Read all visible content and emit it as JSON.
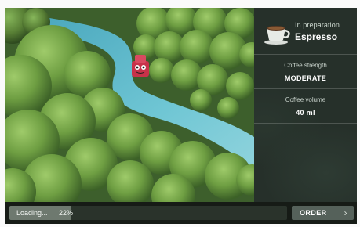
{
  "status": {
    "label": "In preparation",
    "drink": "Espresso"
  },
  "params": {
    "strength": {
      "label": "Coffee strength",
      "value": "MODERATE"
    },
    "volume": {
      "label": "Coffee volume",
      "value": "40 ml"
    }
  },
  "progress": {
    "text": "Loading...",
    "percent_label": "22%",
    "value": 0.22
  },
  "order": {
    "label": "ORDER",
    "chevron": "›"
  },
  "icons": {
    "cup": "coffee-cup-icon",
    "chevron": "chevron-right-icon"
  },
  "colors": {
    "panel": "#26302a",
    "river": "#5fb7c8",
    "broccoli": "#6c9f3e",
    "button": "#55615a"
  }
}
